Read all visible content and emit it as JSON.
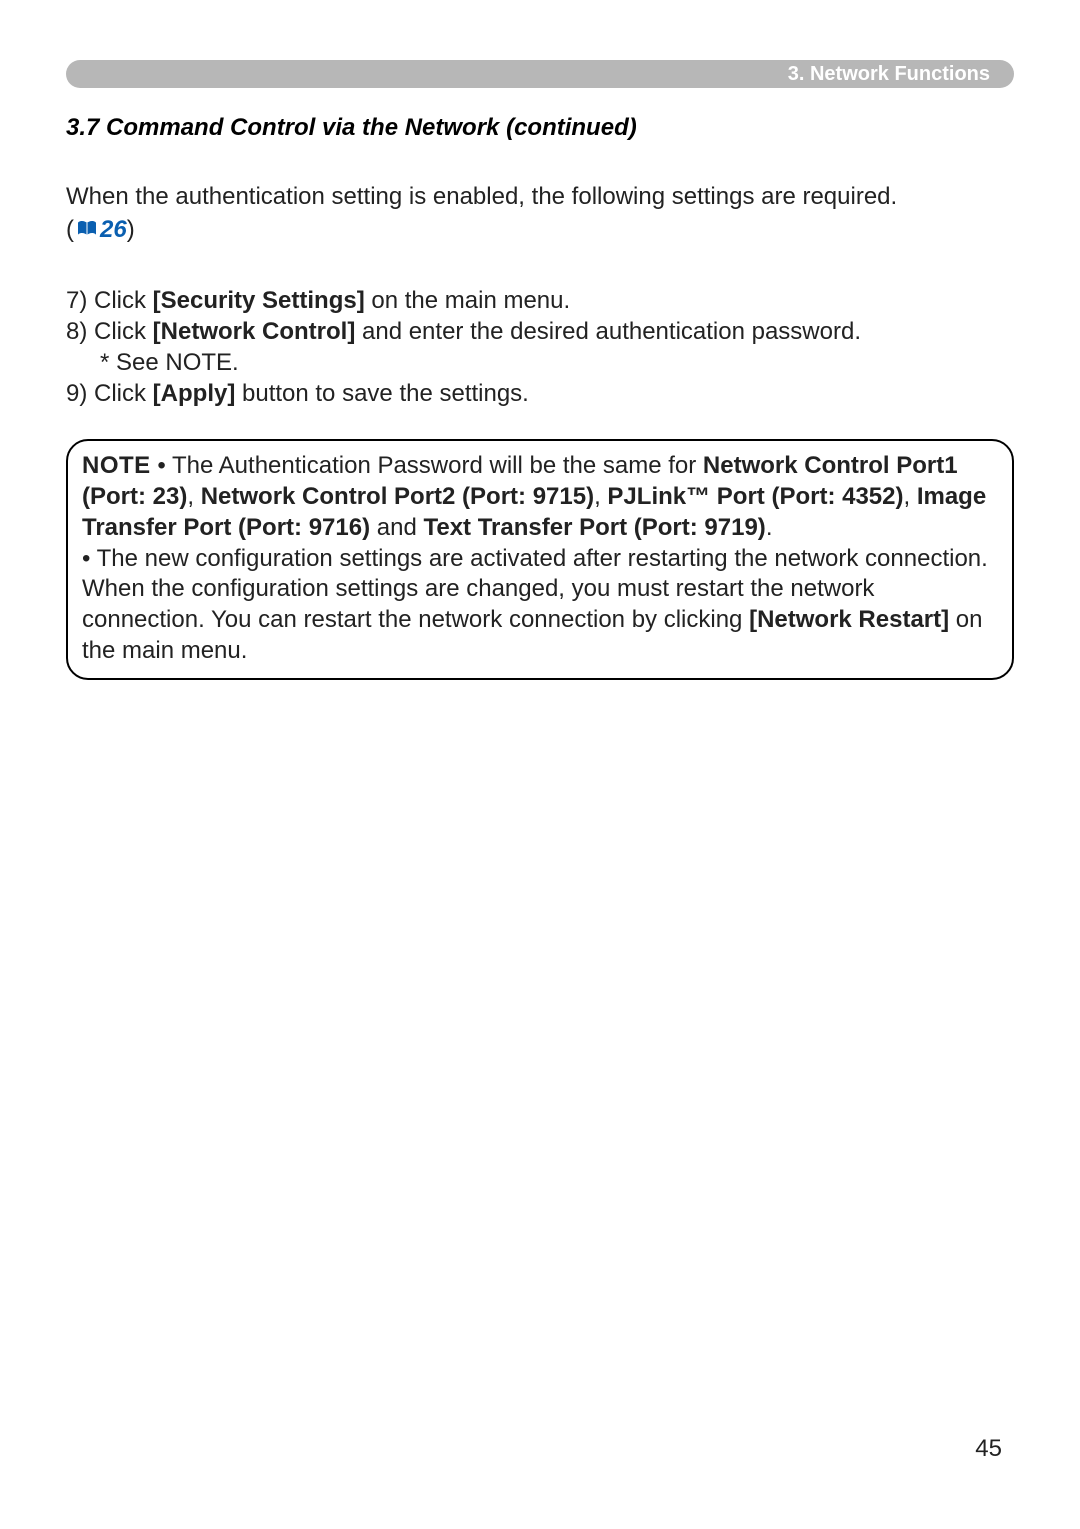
{
  "header": {
    "breadcrumb": "3. Network Functions"
  },
  "section_title": "3.7 Command Control via the Network (continued)",
  "intro": "When the authentication setting is enabled, the following settings are required.",
  "ref": {
    "open": "(",
    "num": "26",
    "close": ")"
  },
  "steps": {
    "s7_prefix": "7) Click ",
    "s7_bold": "[Security Settings]",
    "s7_suffix": " on the main menu.",
    "s8_prefix": "8) Click ",
    "s8_bold": "[Network Control]",
    "s8_suffix": " and enter the desired authentication password.",
    "s8_note": "* See NOTE.",
    "s9_prefix": "9) Click ",
    "s9_bold": "[Apply]",
    "s9_suffix": " button to save the settings."
  },
  "note": {
    "label": "NOTE",
    "t1": "  • The Authentication Password will be the same for ",
    "b1": "Network Control Port1 (Port: 23)",
    "c1": ", ",
    "b2": "Network Control Port2 (Port: 9715)",
    "c2": ", ",
    "b3": "PJLink™ Port (Port: 4352)",
    "c3": ", ",
    "b4": "Image Transfer Port (Port: 9716)",
    "c4": " and ",
    "b5": "Text Transfer Port (Port: 9719)",
    "c5": ".",
    "t2": "• The new configuration settings are activated after restarting the network connection. When the configuration settings are changed, you must restart the network connection. You can restart the network connection by clicking ",
    "b6": "[Network Restart]",
    "t3": " on the main menu."
  },
  "page_number": "45"
}
